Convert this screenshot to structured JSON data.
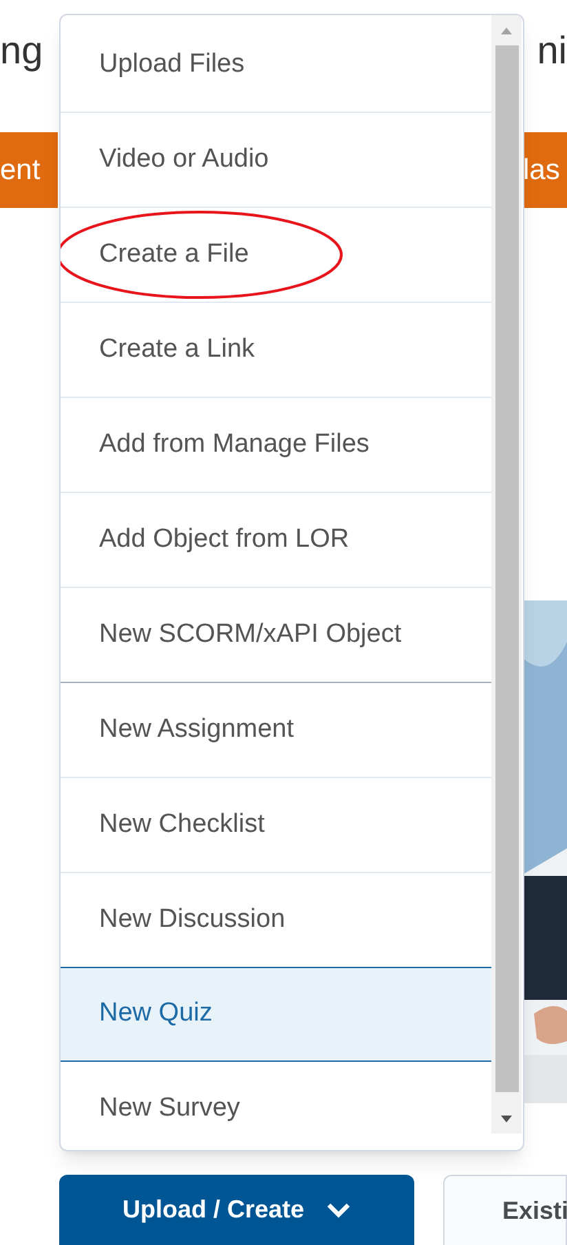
{
  "background": {
    "heading_left": "ng",
    "heading_right": "ni",
    "tab_left": "ent",
    "tab_right": "las"
  },
  "menu": {
    "sections": [
      {
        "items": [
          {
            "label": "Upload Files",
            "selected": false,
            "circled": false
          },
          {
            "label": "Video or Audio",
            "selected": false,
            "circled": false
          },
          {
            "label": "Create a File",
            "selected": false,
            "circled": true
          },
          {
            "label": "Create a Link",
            "selected": false,
            "circled": false
          },
          {
            "label": "Add from Manage Files",
            "selected": false,
            "circled": false
          },
          {
            "label": "Add Object from LOR",
            "selected": false,
            "circled": false
          },
          {
            "label": "New SCORM/xAPI Object",
            "selected": false,
            "circled": false
          }
        ]
      },
      {
        "items": [
          {
            "label": "New Assignment",
            "selected": false,
            "circled": false
          },
          {
            "label": "New Checklist",
            "selected": false,
            "circled": false
          },
          {
            "label": "New Discussion",
            "selected": false,
            "circled": false
          },
          {
            "label": "New Quiz",
            "selected": true,
            "circled": false
          },
          {
            "label": "New Survey",
            "selected": false,
            "circled": false
          }
        ]
      }
    ]
  },
  "buttons": [
    {
      "label": "Upload / Create",
      "kind": "primary"
    },
    {
      "label": "Existi",
      "kind": "secondary"
    }
  ]
}
